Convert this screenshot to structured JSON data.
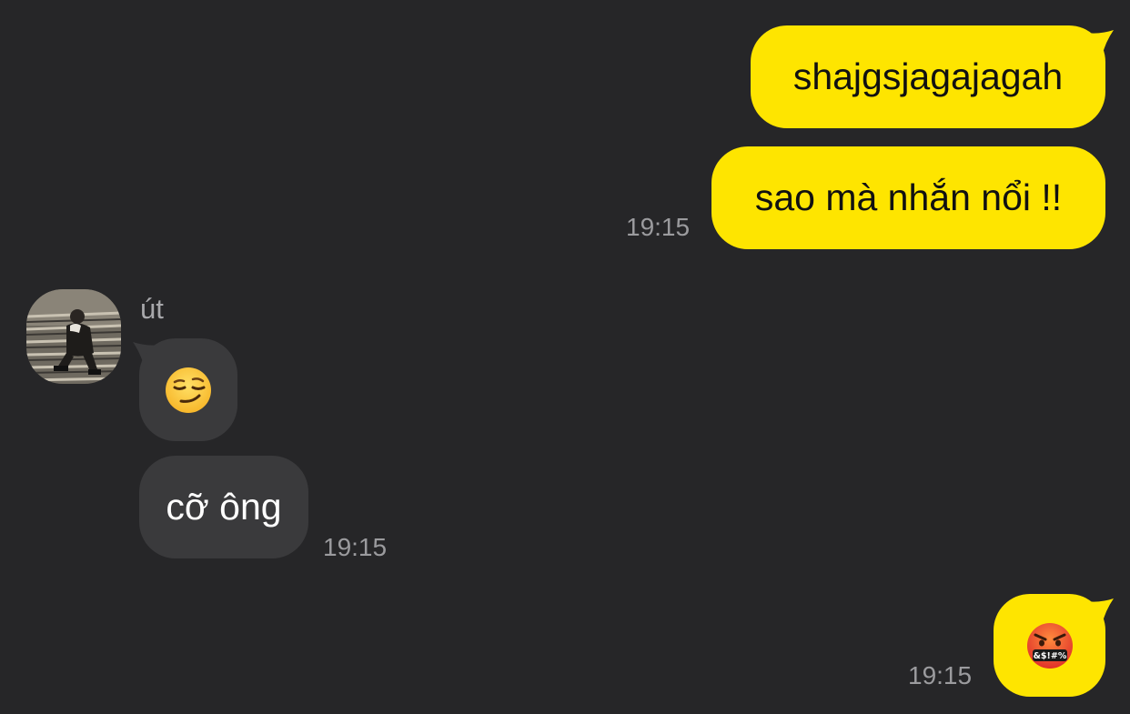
{
  "messages": [
    {
      "id": "m1",
      "direction": "out",
      "text": "shajgsjagajagah"
    },
    {
      "id": "m2",
      "direction": "out",
      "text": "sao mà nhắn nổi !!",
      "time": "19:15"
    },
    {
      "id": "m3",
      "direction": "in",
      "sender": "út",
      "emoji": "smirking-face"
    },
    {
      "id": "m4",
      "direction": "in",
      "text": "cỡ ông",
      "time": "19:15"
    },
    {
      "id": "m5",
      "direction": "out",
      "emoji": "face-with-symbols-on-mouth",
      "emoji_symbols": "&$!#%",
      "time": "19:15"
    }
  ],
  "colors": {
    "background": "#262628",
    "outgoing_bubble": "#FEE500",
    "incoming_bubble": "#3A3A3C",
    "timestamp": "#9B9B9E"
  }
}
